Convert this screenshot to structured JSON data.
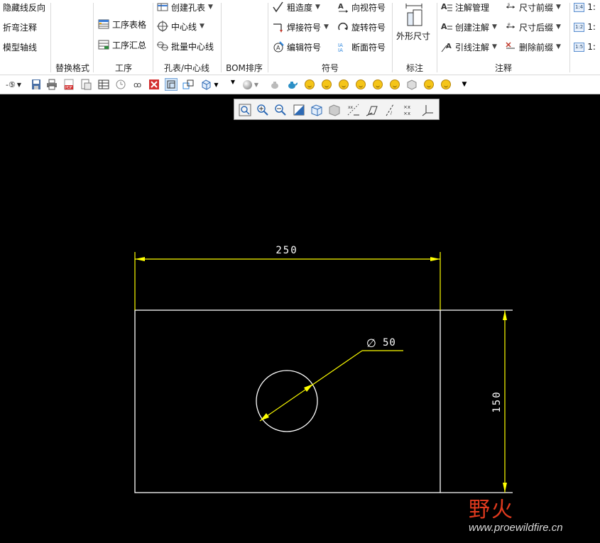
{
  "ribbon": {
    "col1": {
      "items": [
        "隐藏线反向",
        "折弯注释",
        "模型轴线"
      ]
    },
    "col2": {
      "label": "替换格式"
    },
    "col3": {
      "items": [
        "工序表格",
        "工序汇总"
      ],
      "label": "工序"
    },
    "col4": {
      "items": [
        "创建孔表",
        "中心线",
        "批量中心线"
      ],
      "label": "孔表/中心线"
    },
    "col5": {
      "label": "BOM排序"
    },
    "col6": {
      "items_left": [
        "粗造度",
        "焊接符号",
        "编辑符号"
      ],
      "items_right": [
        "向视符号",
        "旋转符号",
        "断面符号"
      ],
      "label": "符号"
    },
    "col7": {
      "item": "外形尺寸",
      "label": "标注"
    },
    "col8": {
      "items_left": [
        "注解管理",
        "创建注解",
        "引线注解"
      ],
      "items_right": [
        "尺寸前缀",
        "尺寸后缀",
        "删除前缀"
      ],
      "label": "注释"
    },
    "col9": {
      "items": [
        "1:",
        "1:",
        "1:"
      ],
      "icons": [
        "1:4",
        "1:2",
        "1:5"
      ]
    }
  },
  "qat": {
    "first": "-⑤"
  },
  "drawing": {
    "dim_width": "250",
    "dim_height": "150",
    "dim_dia": "50",
    "dia_symbol": "∅",
    "colors": {
      "outline": "#ffffff",
      "dimension": "#ffff00",
      "background": "#000000"
    }
  },
  "watermark": {
    "brand": "野火",
    "url": "www.proewildfire.cn"
  }
}
